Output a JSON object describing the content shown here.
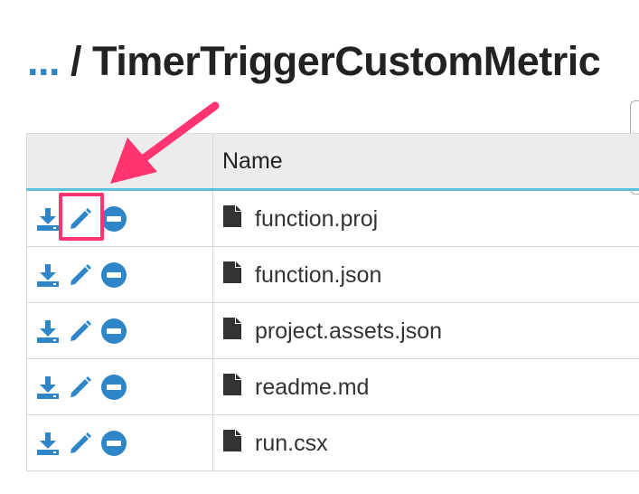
{
  "breadcrumb": {
    "ellipsis": "...",
    "separator": " / ",
    "current": "TimerTriggerCustomMetric"
  },
  "table": {
    "header_name": "Name",
    "rows": [
      {
        "name": "function.proj"
      },
      {
        "name": "function.json"
      },
      {
        "name": "project.assets.json"
      },
      {
        "name": "readme.md"
      },
      {
        "name": "run.csx"
      }
    ]
  },
  "colors": {
    "accent_blue": "#2e86c9",
    "header_underline": "#5bc0de",
    "annotation_pink": "#ff3471"
  },
  "icons": {
    "download": "download-icon",
    "edit": "pencil-icon",
    "remove": "minus-circle-icon",
    "file": "file-icon"
  }
}
